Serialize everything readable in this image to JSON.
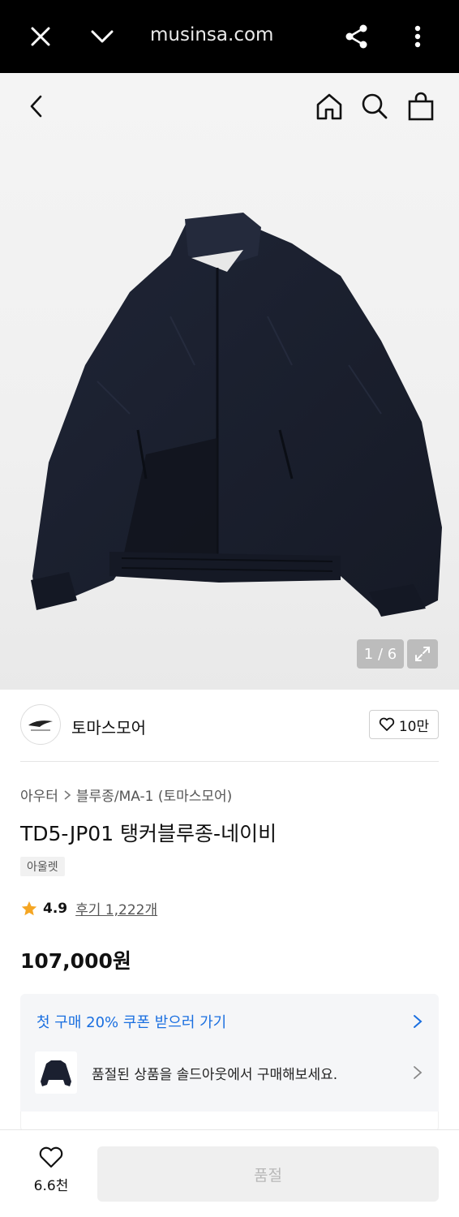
{
  "browser": {
    "url": "musinsa.com",
    "close_icon": "close-icon",
    "collapse_icon": "chevron-down-icon",
    "share_icon": "share-icon",
    "menu_icon": "more-vertical-icon"
  },
  "header": {
    "back_icon": "back-icon",
    "home_icon": "home-icon",
    "search_icon": "search-icon",
    "cart_icon": "bag-icon"
  },
  "gallery": {
    "counter": "1 / 6",
    "current": 1,
    "total": 6
  },
  "brand": {
    "name": "토마스모어",
    "like_count": "10만"
  },
  "product": {
    "category_parent": "아우터",
    "category_child": "블루종/MA-1 (토마스모어)",
    "title": "TD5-JP01 탱커블루종-네이비",
    "tag": "아울렛",
    "rating": "4.9",
    "reviews": "후기 1,222개",
    "price": "107,000원"
  },
  "promo": {
    "coupon": "첫 구매 20% 쿠폰 받으러 가기",
    "soldout_notice": "품절된 상품을 솔드아웃에서 구매해보세요."
  },
  "bottom": {
    "wish_count": "6.6천",
    "buy_label": "품절"
  },
  "colors": {
    "accent_blue": "#1a6fe0",
    "star": "#f5a623",
    "jacket_navy": "#1b2030"
  }
}
